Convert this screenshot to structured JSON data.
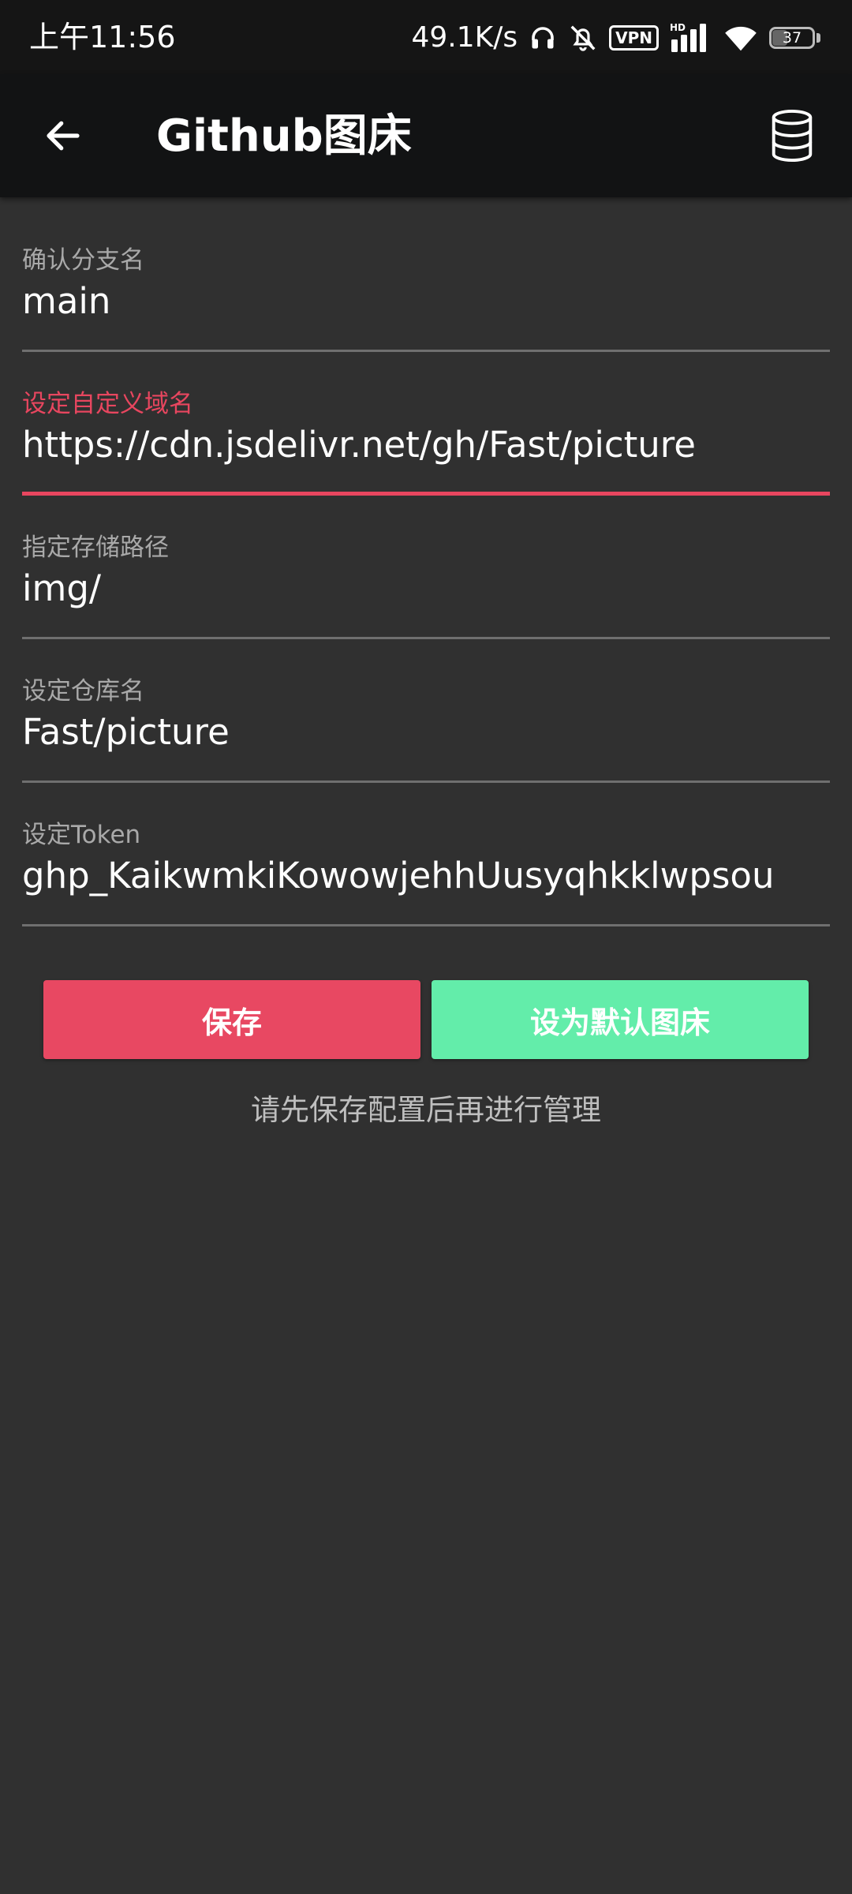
{
  "status_bar": {
    "time": "上午11:56",
    "network_speed": "49.1K/s",
    "vpn_label": "VPN",
    "hd_label": "HD",
    "battery_level": "37",
    "icons": [
      "headphones-icon",
      "bell-off-icon",
      "vpn-icon",
      "signal-icon",
      "wifi-icon",
      "battery-icon"
    ]
  },
  "app_bar": {
    "title": "Github图床",
    "back_icon": "arrow-left-icon",
    "action_icon": "database-icon"
  },
  "form": {
    "fields": [
      {
        "label": "确认分支名",
        "value": "main",
        "focused": false
      },
      {
        "label": "设定自定义域名",
        "value": "https://cdn.jsdelivr.net/gh/Fast/picture",
        "focused": true
      },
      {
        "label": "指定存储路径",
        "value": "img/",
        "focused": false
      },
      {
        "label": "设定仓库名",
        "value": "Fast/picture",
        "focused": false
      },
      {
        "label": "设定Token",
        "value": "ghp_KaikwmkiKowowjehhUusyqhkklwpsou",
        "focused": false
      }
    ]
  },
  "actions": {
    "save_label": "保存",
    "set_default_label": "设为默认图床"
  },
  "hint": "请先保存配置后再进行管理",
  "colors": {
    "background": "#303030",
    "app_bar": "#121314",
    "accent": "#e84862",
    "secondary_button": "#63edaa",
    "divider": "#6f6f6f"
  }
}
